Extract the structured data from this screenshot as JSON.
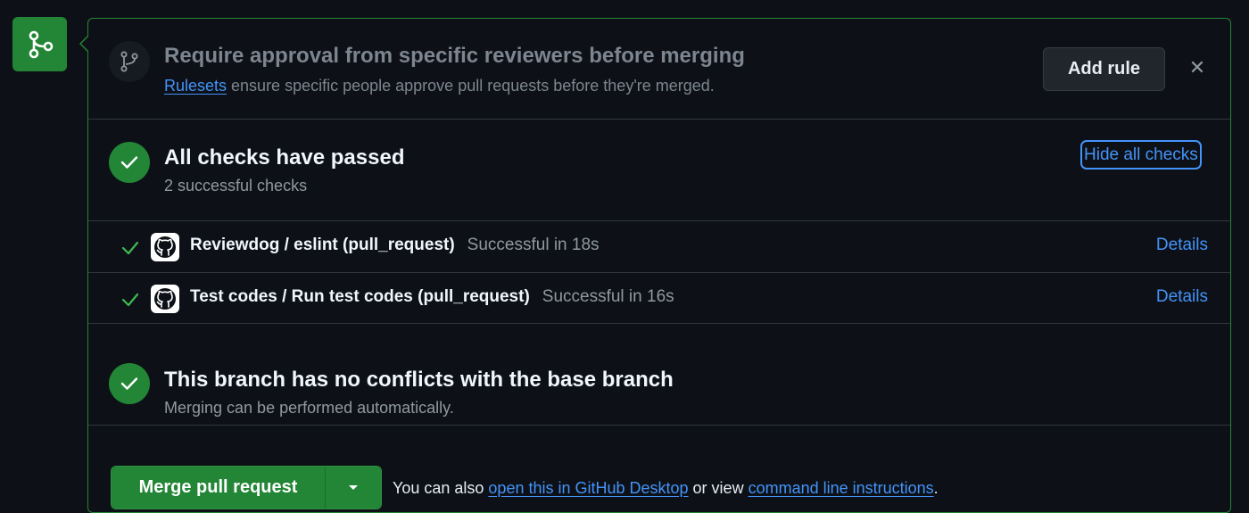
{
  "ruleset": {
    "title": "Require approval from specific reviewers before merging",
    "link": "Rulesets",
    "desc": " ensure specific people approve pull requests before they're merged.",
    "add_rule": "Add rule",
    "close": "✕"
  },
  "checks": {
    "title": "All checks have passed",
    "subtitle": "2 successful checks",
    "hide_label": "Hide all checks",
    "items": [
      {
        "name": "Reviewdog / eslint (pull_request)",
        "status": "Successful in 18s",
        "details": "Details"
      },
      {
        "name": "Test codes / Run test codes (pull_request)",
        "status": "Successful in 16s",
        "details": "Details"
      }
    ]
  },
  "conflicts": {
    "title": "This branch has no conflicts with the base branch",
    "subtitle": "Merging can be performed automatically."
  },
  "merge": {
    "button": "Merge pull request",
    "note_prefix": "You can also ",
    "desktop_link": "open this in GitHub Desktop",
    "note_middle": " or view ",
    "cli_link": "command line instructions",
    "note_suffix": "."
  },
  "icons": {
    "merge": "git-merge-icon",
    "branch": "git-branch-icon",
    "check": "check-icon",
    "github": "github-mark-icon",
    "caret": "triangle-down-icon"
  },
  "colors": {
    "success": "#238636",
    "link": "#4493f8",
    "background": "#0d1117"
  }
}
